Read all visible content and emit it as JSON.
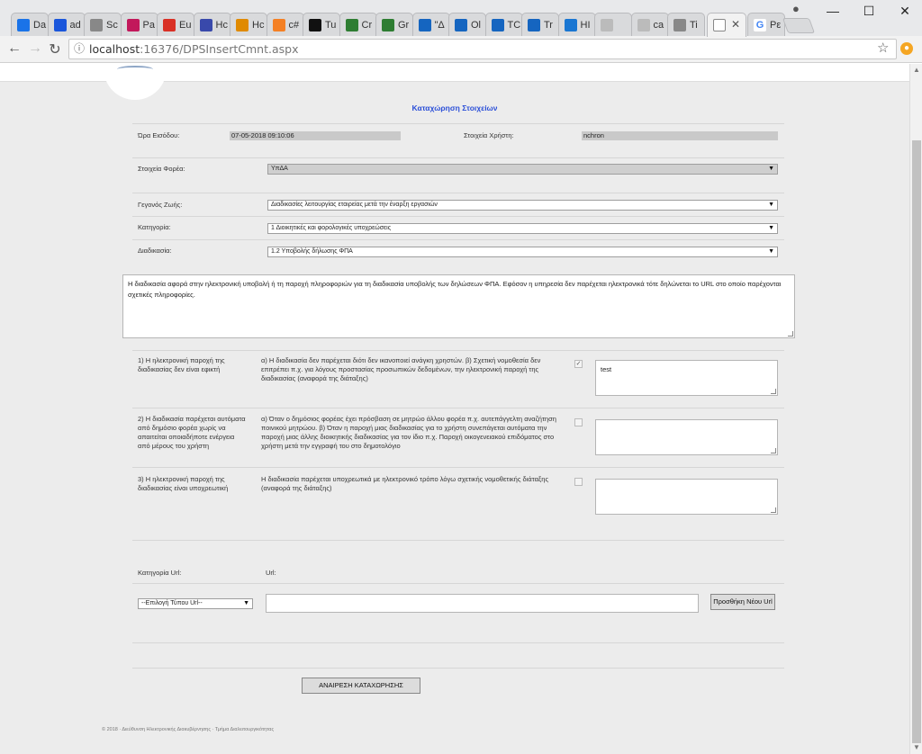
{
  "browser": {
    "tabs": [
      {
        "label": "Da",
        "icon": "check-icon",
        "color": "#1a73e8"
      },
      {
        "label": "ad",
        "icon": "shield-icon",
        "color": "#1a56db"
      },
      {
        "label": "Sc",
        "icon": "page-icon",
        "color": "#888888"
      },
      {
        "label": "Pa",
        "icon": "visual-studio-icon",
        "color": "#c2185b"
      },
      {
        "label": "Eu",
        "icon": "gmail-icon",
        "color": "#d93025"
      },
      {
        "label": "Hc",
        "icon": "shield-icon",
        "color": "#3949ab"
      },
      {
        "label": "Hc",
        "icon": "app-icon",
        "color": "#e08a00"
      },
      {
        "label": "c#",
        "icon": "stack-icon",
        "color": "#f48024"
      },
      {
        "label": "Tu",
        "icon": "m-icon",
        "color": "#111111"
      },
      {
        "label": "Cr",
        "icon": "windows-icon",
        "color": "#2e7d32"
      },
      {
        "label": "Gr",
        "icon": "windows-icon",
        "color": "#2e7d32"
      },
      {
        "label": "\"Δ",
        "icon": "q-icon",
        "color": "#1565c0"
      },
      {
        "label": "Ol",
        "icon": "q-icon",
        "color": "#1565c0"
      },
      {
        "label": "TC",
        "icon": "q-icon",
        "color": "#1565c0"
      },
      {
        "label": "Tr",
        "icon": "q-icon",
        "color": "#1565c0"
      },
      {
        "label": "HI",
        "icon": "if-icon",
        "color": "#1976d2"
      },
      {
        "label": "",
        "icon": "blank-icon",
        "color": "#bbbbbb"
      },
      {
        "label": "ca",
        "icon": "blank-icon",
        "color": "#bbbbbb"
      },
      {
        "label": "Ti",
        "icon": "page-icon",
        "color": "#888888"
      }
    ],
    "active_tab_label": "",
    "last_tab_label": "Pε",
    "address_host": "localhost",
    "address_port_path": ":16376/DPSInsertCmnt.aspx"
  },
  "page": {
    "title": "Καταχώρηση Στοιχείων",
    "entry_time_label": "Ώρα Εισόδου:",
    "entry_time_value": "07-05-2018 09:10:06",
    "user_label": "Στοιχεία Χρήστη:",
    "user_value": "nchron",
    "agency_label": "Στοιχεία Φορέα:",
    "agency_value": "ΥπΔΑ",
    "life_event_label": "Γεγονός Ζωής:",
    "life_event_value": "Διαδικασίες λειτουργίας εταιρείας μετά την έναρξη εργασιών",
    "category_label": "Κατηγορία:",
    "category_value": "1 Διοικητικές και φορολογικές υποχρεώσεις",
    "procedure_label": "Διαδικασία:",
    "procedure_value": "1.2 Υποβολής δήλωσης ΦΠΑ",
    "description": "Η διαδικασία αφορά στην ηλεκτρονική υποβολή ή τη παροχή πληροφοριών για τη διαδικασία υποβολής των δηλώσεων ΦΠΑ.  Εφόσον η υπηρεσία δεν παρέχεται ηλεκτρονικά τότε δηλώνεται το URL στο οποίο παρέχονται σχετικές πληροφορίες.",
    "options": [
      {
        "question": "1) Η ηλεκτρονική παροχή της διαδικασίας δεν είναι εφικτή",
        "explanation": "α) Η διαδικασία δεν παρέχεται διότι δεν ικανοποιεί ανάγκη χρηστών. β) Σχετική νομοθεσία δεν επιτρέπει π.χ. για λόγους προστασίας προσωπικών δεδομένων, την ηλεκτρονική παροχή της διαδικασίας (αναφορά της διάταξης)",
        "checked": "✓",
        "comment": "test"
      },
      {
        "question": "2) Η διαδικασία παρέχεται αυτόματα από δημόσιο φορέα χωρίς να απαιτείται οποιαδήποτε ενέργεια από μέρους του χρήστη",
        "explanation": "α) Όταν ο δημόσιος φορέας έχει πρόσβαση σε μητρώο άλλου φορέα π.χ. αυτεπάγγελτη αναζήτηση ποινικού μητρώου. β) Όταν η παροχή μιας διαδικασίας για το χρήστη συνεπάγεται αυτόματα την παροχή μιας άλλης διοικητικής διαδικασίας για τον ίδιο π.χ. Παροχή οικογενειακού επιδόματος στο χρήστη μετά την εγγραφή του στο δημοτολόγιο",
        "checked": "",
        "comment": ""
      },
      {
        "question": "3) Η ηλεκτρονική παροχή της διαδικασίας είναι υποχρεωτική",
        "explanation": "Η διαδικασία παρέχεται υποχρεωτικά με ηλεκτρονικό τρόπο λόγω σχετικής νομοθετικής διάταξης (αναφορά της διάταξης)",
        "checked": "",
        "comment": ""
      }
    ],
    "url_category_label": "Κατηγορία Url:",
    "url_label": "Url:",
    "url_type_placeholder": "--Επιλογή Τύπου Url--",
    "add_url_button": "Προσθήκη Νέου Url",
    "cancel_button": "ΑΝΑΙΡΕΣΗ ΚΑΤΑΧΩΡΗΣΗΣ",
    "footer": "© 2018 · Διεύθυνση Ηλεκτρονικής Διακυβέρνησης · Τμήμα Διαλειτουργικότητας"
  }
}
